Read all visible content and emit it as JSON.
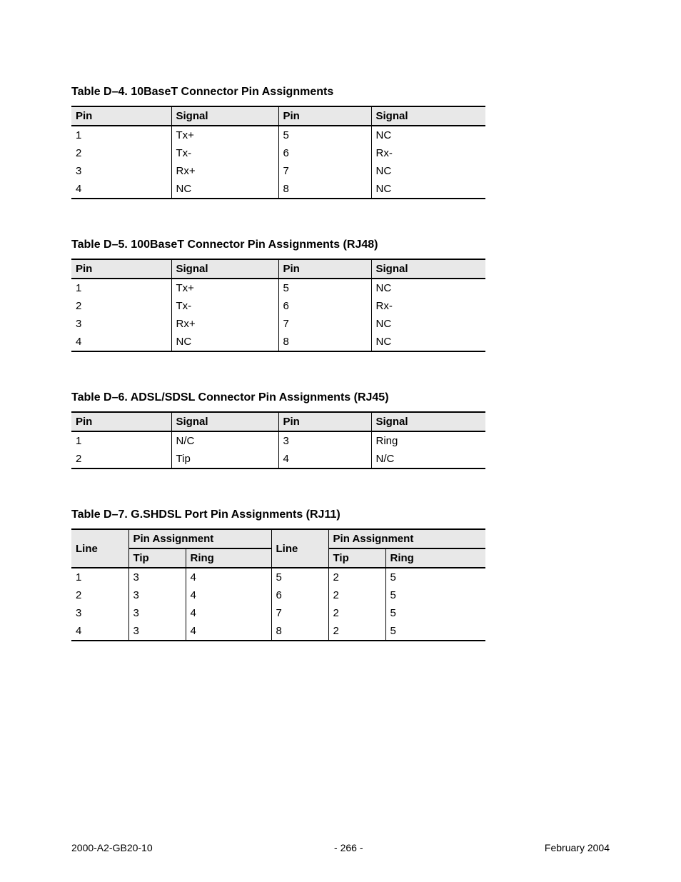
{
  "tables": {
    "d4": {
      "caption": "Table D–4.  10BaseT Connector Pin Assignments",
      "headers": [
        "Pin",
        "Signal",
        "Pin",
        "Signal"
      ],
      "rows": [
        [
          "1",
          "Tx+",
          "5",
          "NC"
        ],
        [
          "2",
          "Tx-",
          "6",
          "Rx-"
        ],
        [
          "3",
          "Rx+",
          "7",
          "NC"
        ],
        [
          "4",
          "NC",
          "8",
          "NC"
        ]
      ]
    },
    "d5": {
      "caption": "Table D–5.  100BaseT Connector Pin Assignments (RJ48)",
      "headers": [
        "Pin",
        "Signal",
        "Pin",
        "Signal"
      ],
      "rows": [
        [
          "1",
          "Tx+",
          "5",
          "NC"
        ],
        [
          "2",
          "Tx-",
          "6",
          "Rx-"
        ],
        [
          "3",
          "Rx+",
          "7",
          "NC"
        ],
        [
          "4",
          "NC",
          "8",
          "NC"
        ]
      ]
    },
    "d6": {
      "caption": "Table D–6.  ADSL/SDSL Connector Pin Assignments (RJ45)",
      "headers": [
        "Pin",
        "Signal",
        "Pin",
        "Signal"
      ],
      "rows": [
        [
          "1",
          "N/C",
          "3",
          "Ring"
        ],
        [
          "2",
          "Tip",
          "4",
          "N/C"
        ]
      ]
    },
    "d7": {
      "caption": "Table D–7.  G.SHDSL Port Pin Assignments (RJ11)",
      "headers_top": [
        "Line",
        "Pin Assignment",
        "Line",
        "Pin Assignment"
      ],
      "headers_sub": [
        "Tip",
        "Ring",
        "Tip",
        "Ring"
      ],
      "rows": [
        [
          "1",
          "3",
          "4",
          "5",
          "2",
          "5"
        ],
        [
          "2",
          "3",
          "4",
          "6",
          "2",
          "5"
        ],
        [
          "3",
          "3",
          "4",
          "7",
          "2",
          "5"
        ],
        [
          "4",
          "3",
          "4",
          "8",
          "2",
          "5"
        ]
      ]
    }
  },
  "footer": {
    "left": "2000-A2-GB20-10",
    "center": "- 266 -",
    "right": "February 2004"
  }
}
